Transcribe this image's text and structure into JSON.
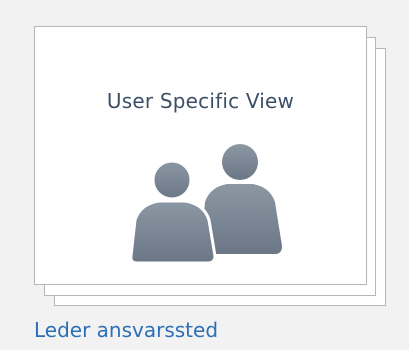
{
  "tile": {
    "title": "User Specific View",
    "icon": "users-icon",
    "link_label": "Leder ansvarssted"
  },
  "colors": {
    "background": "#f2f2f2",
    "card": "#ffffff",
    "title": "#3d4f66",
    "icon": "#7b8796",
    "link": "#2c6fb6"
  }
}
